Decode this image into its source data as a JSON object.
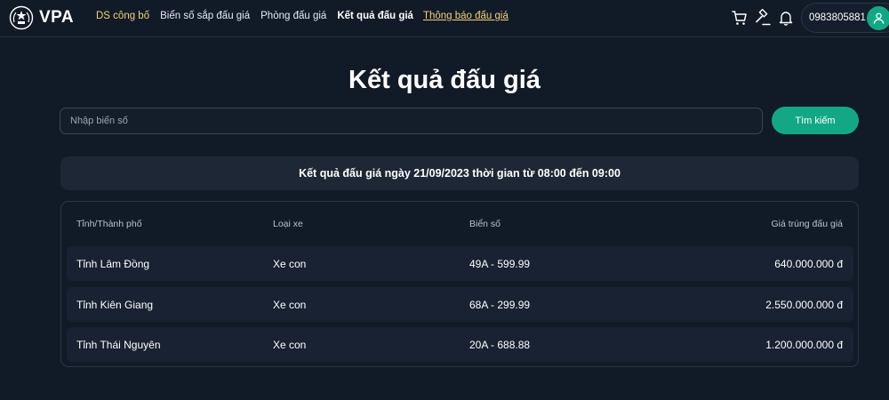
{
  "header": {
    "brand": "VPA",
    "nav": [
      {
        "label": "DS công bố"
      },
      {
        "label": "Biển số sắp đấu giá"
      },
      {
        "label": "Phòng đấu giá"
      },
      {
        "label": "Kết quả đấu giá"
      },
      {
        "label": "Thông báo đấu giá"
      }
    ],
    "phone": "0983805881",
    "icons": [
      "cart-icon",
      "gavel-icon",
      "bell-icon",
      "user-icon"
    ]
  },
  "page": {
    "title": "Kết quả đấu giá"
  },
  "search": {
    "placeholder": "Nhập biển số",
    "value": "",
    "button_label": "Tìm kiếm"
  },
  "session": {
    "text": "Kết quả đấu giá ngày 21/09/2023 thời gian từ 08:00 đến 09:00"
  },
  "table": {
    "columns": [
      "Tỉnh/Thành phố",
      "Loại xe",
      "Biển số",
      "Giá trúng đấu giá"
    ],
    "rows": [
      {
        "province": "Tỉnh Lâm Đồng",
        "vehicle_type": "Xe con",
        "plate": "49A - 599.99",
        "price": "640.000.000 đ"
      },
      {
        "province": "Tỉnh Kiên Giang",
        "vehicle_type": "Xe con",
        "plate": "68A - 299.99",
        "price": "2.550.000.000 đ"
      },
      {
        "province": "Tỉnh Thái Nguyên",
        "vehicle_type": "Xe con",
        "plate": "20A - 688.88",
        "price": "1.200.000.000 đ"
      }
    ]
  },
  "colors": {
    "background": "#111a27",
    "accent": "#12a886",
    "nav_highlight": "#f2d27a"
  }
}
